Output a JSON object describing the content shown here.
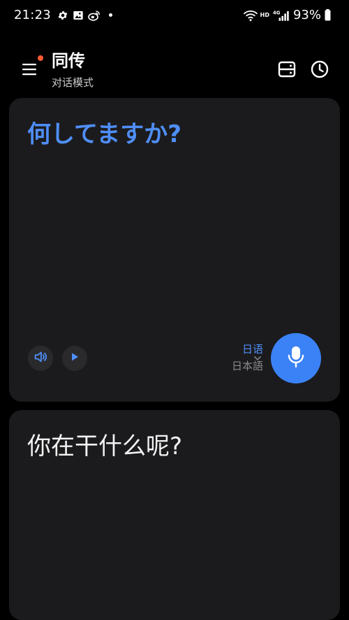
{
  "status_bar": {
    "time": "21:23",
    "network": "4G",
    "hd": "HD",
    "battery_percent": "93%",
    "icons": [
      "settings-gear-icon",
      "gallery-image-icon",
      "weibo-icon",
      "notification-dot",
      "wifi-icon",
      "signal-icon",
      "battery-icon"
    ]
  },
  "header": {
    "title": "同传",
    "subtitle": "对话模式",
    "icons": [
      "menu-icon",
      "storage-icon",
      "history-clock-icon"
    ]
  },
  "source_card": {
    "text": "何してますか?",
    "language_label": "日语",
    "language_native": "日本語",
    "icons": [
      "speaker-icon",
      "play-icon",
      "chevron-down-icon",
      "microphone-icon"
    ]
  },
  "target_card": {
    "text": "你在干什么呢?"
  },
  "colors": {
    "accent": "#4f8ef7",
    "mic_button": "#3b82f6",
    "card_bg": "#1b1b1d",
    "badge": "#ff5a36"
  }
}
